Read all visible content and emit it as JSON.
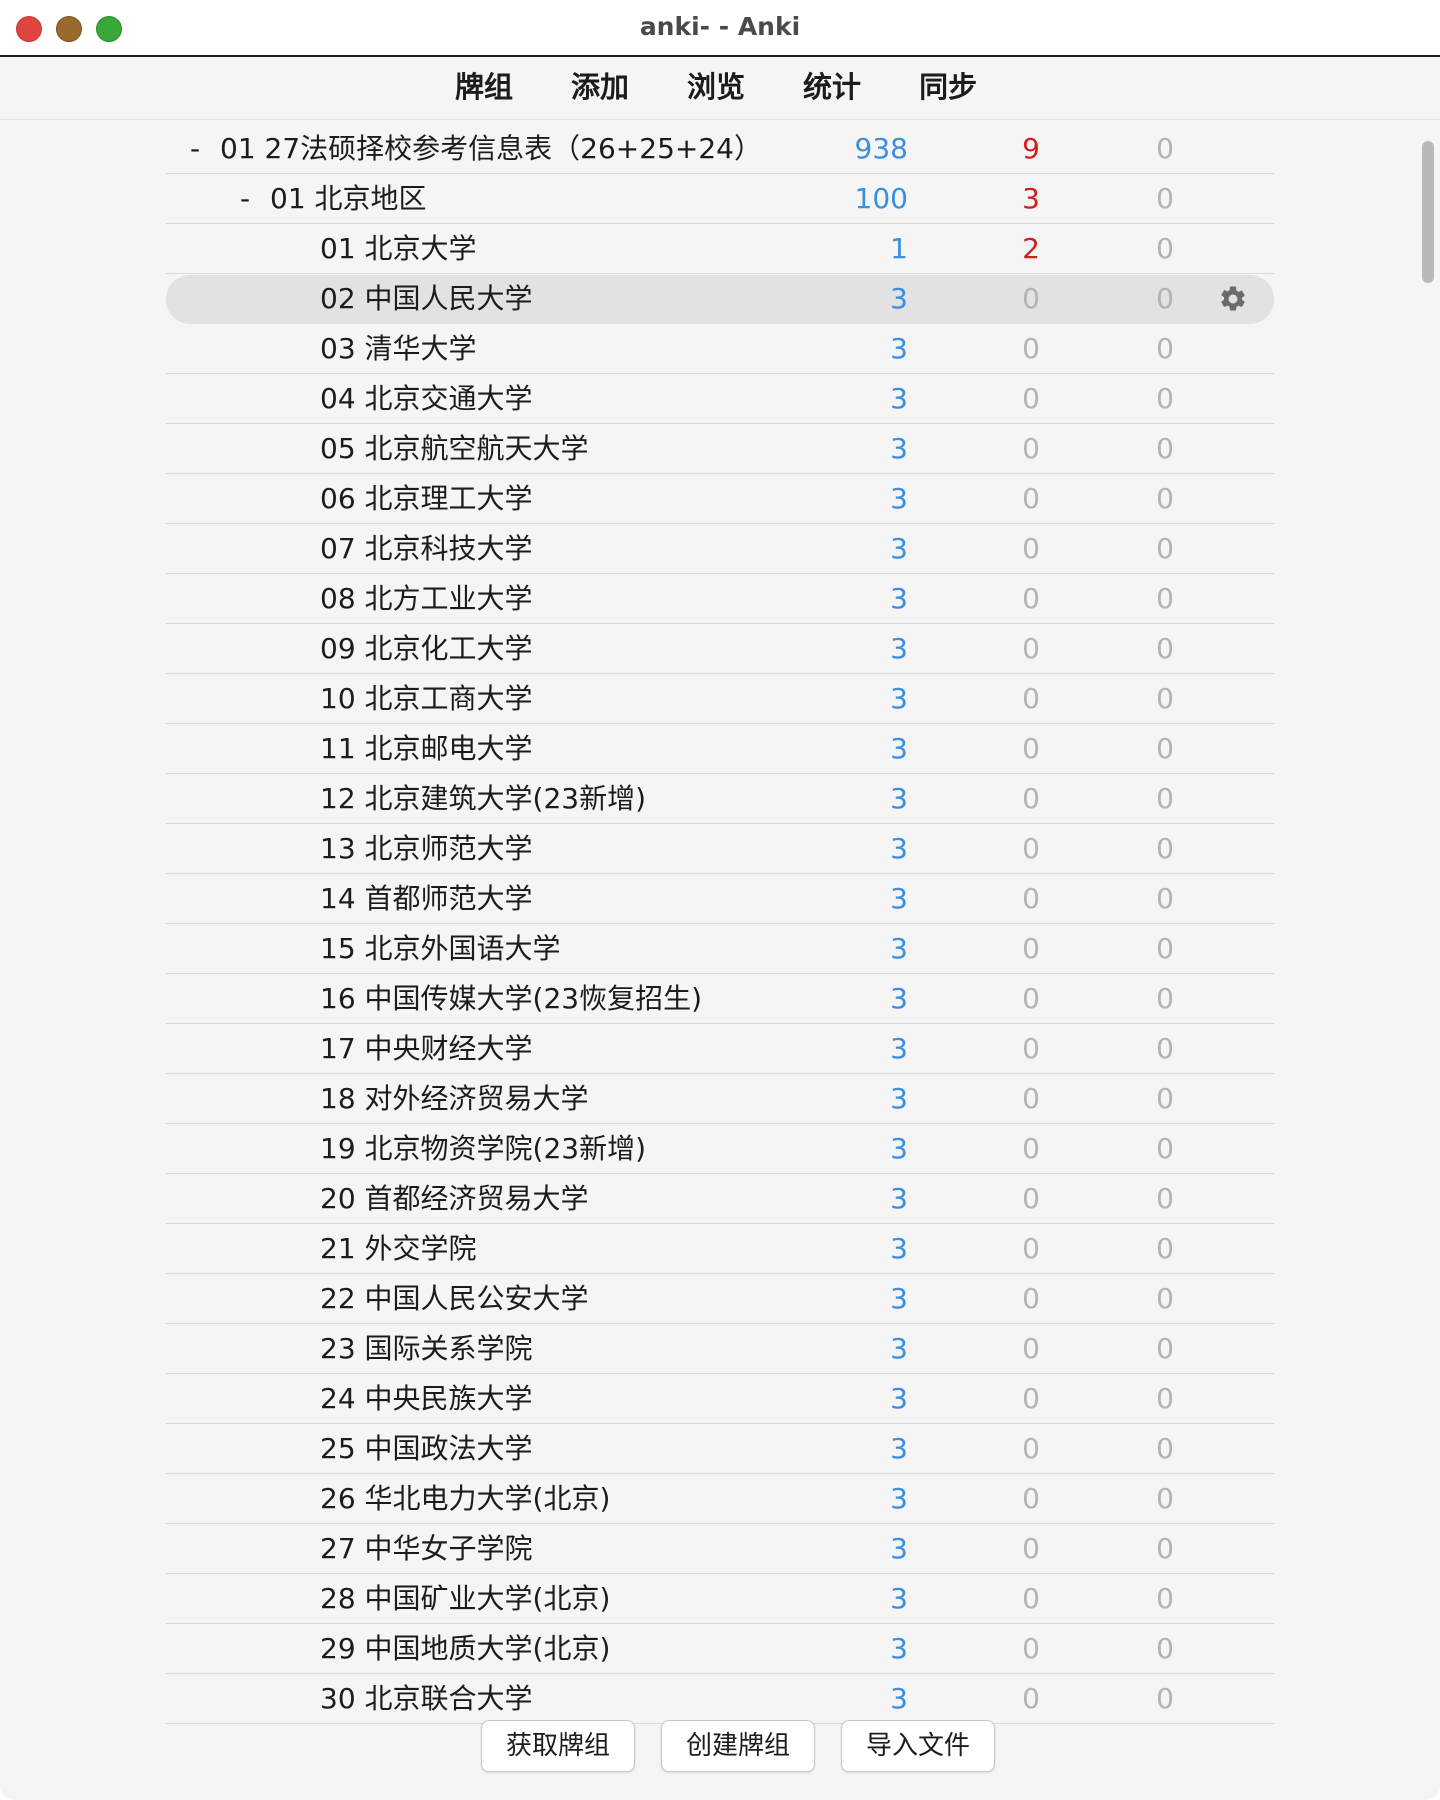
{
  "window": {
    "title": "anki- - Anki"
  },
  "toolbar": {
    "items": [
      "牌组",
      "添加",
      "浏览",
      "统计",
      "同步"
    ]
  },
  "decks": [
    {
      "name": "01 27法硕择校参考信息表（26+25+24）",
      "level": 0,
      "collapse": "-",
      "new": "938",
      "learn": "9",
      "review": "0",
      "learn_color": "red"
    },
    {
      "name": "01 北京地区",
      "level": 1,
      "collapse": "-",
      "new": "100",
      "learn": "3",
      "review": "0",
      "learn_color": "red"
    },
    {
      "name": "01 北京大学",
      "level": 2,
      "collapse": "",
      "new": "1",
      "learn": "2",
      "review": "0",
      "learn_color": "red"
    },
    {
      "name": "02 中国人民大学",
      "level": 2,
      "collapse": "",
      "new": "3",
      "learn": "0",
      "review": "0",
      "learn_color": "grey",
      "current": true
    },
    {
      "name": "03 清华大学",
      "level": 2,
      "collapse": "",
      "new": "3",
      "learn": "0",
      "review": "0",
      "learn_color": "grey"
    },
    {
      "name": "04 北京交通大学",
      "level": 2,
      "collapse": "",
      "new": "3",
      "learn": "0",
      "review": "0",
      "learn_color": "grey"
    },
    {
      "name": "05 北京航空航天大学",
      "level": 2,
      "collapse": "",
      "new": "3",
      "learn": "0",
      "review": "0",
      "learn_color": "grey"
    },
    {
      "name": "06 北京理工大学",
      "level": 2,
      "collapse": "",
      "new": "3",
      "learn": "0",
      "review": "0",
      "learn_color": "grey"
    },
    {
      "name": "07 北京科技大学",
      "level": 2,
      "collapse": "",
      "new": "3",
      "learn": "0",
      "review": "0",
      "learn_color": "grey"
    },
    {
      "name": "08 北方工业大学",
      "level": 2,
      "collapse": "",
      "new": "3",
      "learn": "0",
      "review": "0",
      "learn_color": "grey"
    },
    {
      "name": "09 北京化工大学",
      "level": 2,
      "collapse": "",
      "new": "3",
      "learn": "0",
      "review": "0",
      "learn_color": "grey"
    },
    {
      "name": "10 北京工商大学",
      "level": 2,
      "collapse": "",
      "new": "3",
      "learn": "0",
      "review": "0",
      "learn_color": "grey"
    },
    {
      "name": "11 北京邮电大学",
      "level": 2,
      "collapse": "",
      "new": "3",
      "learn": "0",
      "review": "0",
      "learn_color": "grey"
    },
    {
      "name": "12 北京建筑大学(23新增)",
      "level": 2,
      "collapse": "",
      "new": "3",
      "learn": "0",
      "review": "0",
      "learn_color": "grey"
    },
    {
      "name": "13 北京师范大学",
      "level": 2,
      "collapse": "",
      "new": "3",
      "learn": "0",
      "review": "0",
      "learn_color": "grey"
    },
    {
      "name": "14 首都师范大学",
      "level": 2,
      "collapse": "",
      "new": "3",
      "learn": "0",
      "review": "0",
      "learn_color": "grey"
    },
    {
      "name": "15 北京外国语大学",
      "level": 2,
      "collapse": "",
      "new": "3",
      "learn": "0",
      "review": "0",
      "learn_color": "grey"
    },
    {
      "name": "16 中国传媒大学(23恢复招生)",
      "level": 2,
      "collapse": "",
      "new": "3",
      "learn": "0",
      "review": "0",
      "learn_color": "grey"
    },
    {
      "name": "17 中央财经大学",
      "level": 2,
      "collapse": "",
      "new": "3",
      "learn": "0",
      "review": "0",
      "learn_color": "grey"
    },
    {
      "name": "18 对外经济贸易大学",
      "level": 2,
      "collapse": "",
      "new": "3",
      "learn": "0",
      "review": "0",
      "learn_color": "grey"
    },
    {
      "name": "19 北京物资学院(23新增)",
      "level": 2,
      "collapse": "",
      "new": "3",
      "learn": "0",
      "review": "0",
      "learn_color": "grey"
    },
    {
      "name": "20 首都经济贸易大学",
      "level": 2,
      "collapse": "",
      "new": "3",
      "learn": "0",
      "review": "0",
      "learn_color": "grey"
    },
    {
      "name": "21 外交学院",
      "level": 2,
      "collapse": "",
      "new": "3",
      "learn": "0",
      "review": "0",
      "learn_color": "grey"
    },
    {
      "name": "22 中国人民公安大学",
      "level": 2,
      "collapse": "",
      "new": "3",
      "learn": "0",
      "review": "0",
      "learn_color": "grey"
    },
    {
      "name": "23 国际关系学院",
      "level": 2,
      "collapse": "",
      "new": "3",
      "learn": "0",
      "review": "0",
      "learn_color": "grey"
    },
    {
      "name": "24 中央民族大学",
      "level": 2,
      "collapse": "",
      "new": "3",
      "learn": "0",
      "review": "0",
      "learn_color": "grey"
    },
    {
      "name": "25 中国政法大学",
      "level": 2,
      "collapse": "",
      "new": "3",
      "learn": "0",
      "review": "0",
      "learn_color": "grey"
    },
    {
      "name": "26 华北电力大学(北京)",
      "level": 2,
      "collapse": "",
      "new": "3",
      "learn": "0",
      "review": "0",
      "learn_color": "grey"
    },
    {
      "name": "27 中华女子学院",
      "level": 2,
      "collapse": "",
      "new": "3",
      "learn": "0",
      "review": "0",
      "learn_color": "grey"
    },
    {
      "name": "28 中国矿业大学(北京)",
      "level": 2,
      "collapse": "",
      "new": "3",
      "learn": "0",
      "review": "0",
      "learn_color": "grey"
    },
    {
      "name": "29 中国地质大学(北京)",
      "level": 2,
      "collapse": "",
      "new": "3",
      "learn": "0",
      "review": "0",
      "learn_color": "grey"
    },
    {
      "name": "30 北京联合大学",
      "level": 2,
      "collapse": "",
      "new": "3",
      "learn": "0",
      "review": "0",
      "learn_color": "grey"
    }
  ],
  "bottom": {
    "get_shared": "获取牌组",
    "create_deck": "创建牌组",
    "import_file": "导入文件"
  },
  "colors": {
    "new": "#3a8fe0",
    "learn_red": "#d11f1f",
    "zero_grey": "#b3b3b3",
    "current_row": "#e2e2e2"
  },
  "icons": {
    "options": "gear-icon",
    "window_close": "close-icon",
    "window_minimize": "minimize-icon",
    "window_zoom": "zoom-icon"
  }
}
